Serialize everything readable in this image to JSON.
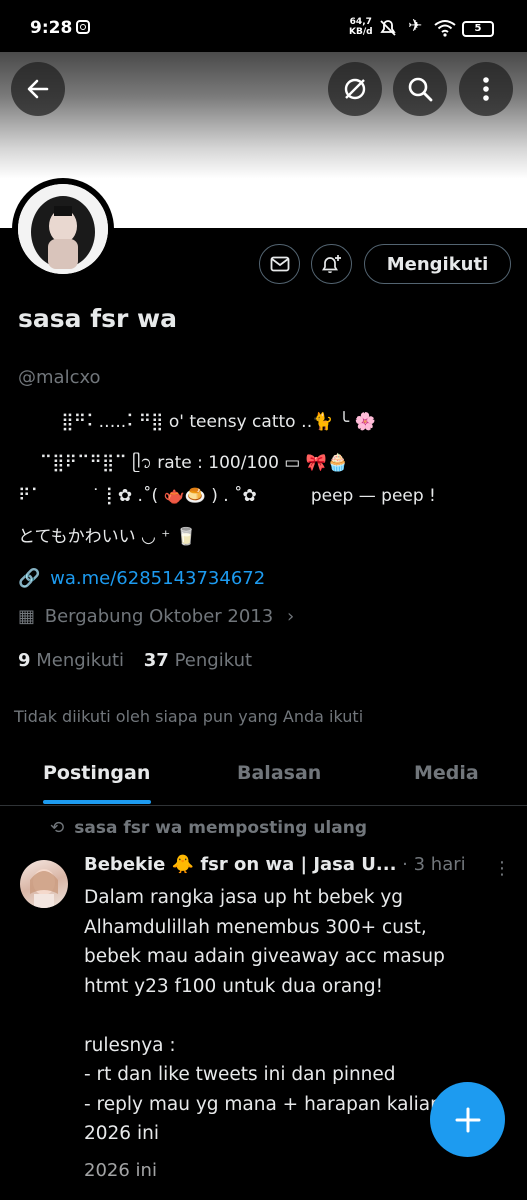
{
  "status_bar": {
    "time": "9:28",
    "speed_value": "64,7",
    "speed_unit": "KB/d",
    "battery": "5"
  },
  "header": {
    "back_icon": "arrow-left-icon",
    "hide_icon": "eye-off-icon",
    "search_icon": "search-icon",
    "more_icon": "more-vertical-icon"
  },
  "profile": {
    "display_name": "sasa fsr wa",
    "handle": "@malcxo",
    "follow_button": "Mengikuti",
    "bio": [
      "        ⣿⠛⠅.‥..⠅⠛⣿ o' teensy catto ‥🐈 ╰ 🌸",
      "    ⠉⣿⠟⠉⠛⣿⠉ ᥫ᭡ rate : 100/100 ▭ 🎀🧁",
      "⠟⠁         ˙ ⡇✿ .˚( 🫖🍮 ) . ˚✿          peep — peep !",
      "とてもかわいい ◡ ⁺ 🥛"
    ],
    "link": "wa.me/6285143734672",
    "joined": "Bergabung Oktober 2013",
    "following_count": "9",
    "following_label": "Mengikuti",
    "followers_count": "37",
    "followers_label": "Pengikut",
    "followed_by": "Tidak diikuti oleh siapa pun yang Anda ikuti",
    "colors": {
      "accent": "#1d9bf0",
      "muted": "#71767b",
      "text": "#e7e9ea"
    }
  },
  "tabs": [
    {
      "label": "Postingan",
      "active": true
    },
    {
      "label": "Balasan",
      "active": false
    },
    {
      "label": "Media",
      "active": false
    }
  ],
  "post": {
    "repost_label": "sasa fsr wa memposting ulang",
    "author": "Bebekie 🐥 fsr on wa | Jasa U...",
    "time": "· 3 hari",
    "lines": [
      "Dalam rangka jasa up ht bebek yg",
      "Alhamdulillah menembus 300+ cust,",
      "bebek mau adain giveaway acc masup",
      "htmt y23 f100 untuk dua orang!",
      "",
      "rulesnya :",
      "- rt dan like tweets ini dan pinned",
      "- reply mau yg mana + harapan kalian",
      "2026 ini"
    ],
    "next_line": "2026 ini"
  },
  "fab": {
    "icon": "plus-icon"
  }
}
